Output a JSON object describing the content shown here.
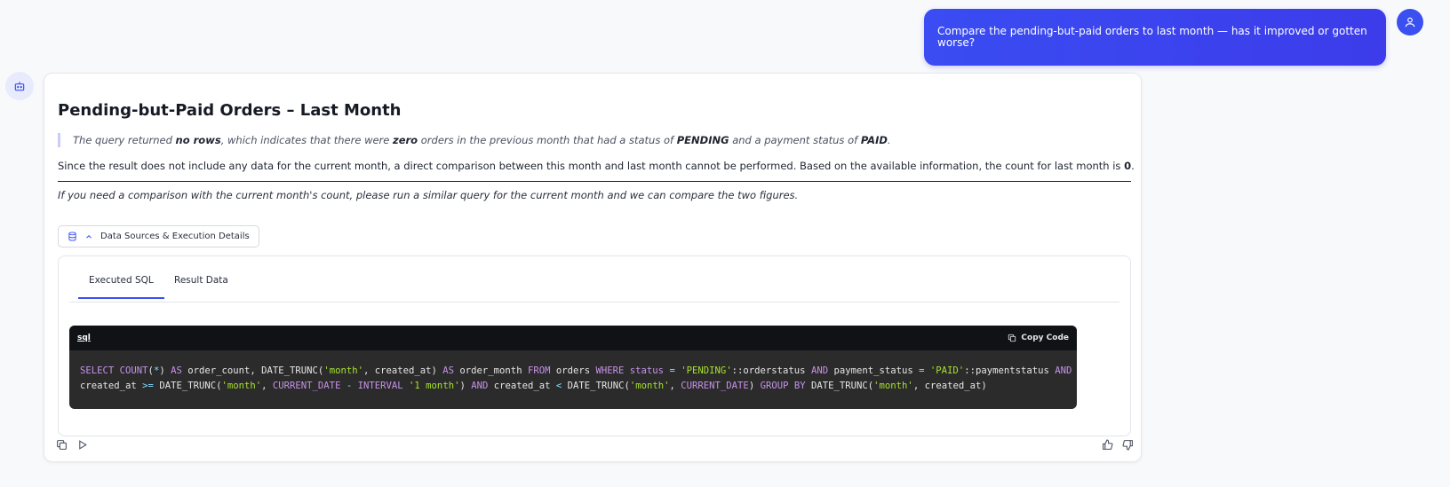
{
  "user_message": {
    "text": "Compare the pending-but-paid orders to last month — has it improved or gotten worse?"
  },
  "assistant": {
    "title": "Pending-but-Paid Orders – Last Month",
    "quote": {
      "part1": "The query returned ",
      "bold1": "no rows",
      "part2": ", which indicates that there were ",
      "bold2": "zero",
      "part3": " orders in the previous month that had a status of ",
      "bold3": "PENDING",
      "part4": " and a payment status of ",
      "bold4": "PAID",
      "part5": "."
    },
    "paragraph": {
      "text": "Since the result does not include any data for the current month, a direct comparison between this month and last month cannot be performed. Based on the available information, the count for last month is ",
      "bold": "0",
      "end": "."
    },
    "italic_note": "If you need a comparison with the current month's count, please run a similar query for the current month and we can compare the two figures.",
    "data_sources_label": "Data Sources & Execution Details",
    "tabs": [
      "Executed SQL",
      "Result Data"
    ],
    "code": {
      "language": "sql",
      "copy_label": "Copy Code",
      "tokens_line1": [
        {
          "t": "SELECT ",
          "c": "kw"
        },
        {
          "t": "COUNT",
          "c": "kw"
        },
        {
          "t": "(",
          "c": ""
        },
        {
          "t": "*",
          "c": "op"
        },
        {
          "t": ") ",
          "c": ""
        },
        {
          "t": "AS",
          "c": "kw"
        },
        {
          "t": " order_count, DATE_TRUNC(",
          "c": ""
        },
        {
          "t": "'month'",
          "c": "str"
        },
        {
          "t": ", created_at) ",
          "c": ""
        },
        {
          "t": "AS",
          "c": "kw"
        },
        {
          "t": " order_month ",
          "c": ""
        },
        {
          "t": "FROM",
          "c": "kw"
        },
        {
          "t": " orders ",
          "c": ""
        },
        {
          "t": "WHERE",
          "c": "kw"
        },
        {
          "t": " ",
          "c": ""
        },
        {
          "t": "status",
          "c": "kw"
        },
        {
          "t": " ",
          "c": ""
        },
        {
          "t": "=",
          "c": "op"
        },
        {
          "t": " ",
          "c": ""
        },
        {
          "t": "'PENDING'",
          "c": "str"
        },
        {
          "t": "::orderstatus ",
          "c": ""
        },
        {
          "t": "AND",
          "c": "kw"
        },
        {
          "t": " payment_status ",
          "c": ""
        },
        {
          "t": "=",
          "c": "op"
        },
        {
          "t": " ",
          "c": ""
        },
        {
          "t": "'PAID'",
          "c": "str"
        },
        {
          "t": "::paymentstatus ",
          "c": ""
        },
        {
          "t": "AND",
          "c": "kw"
        }
      ],
      "tokens_line2": [
        {
          "t": "created_at ",
          "c": ""
        },
        {
          "t": ">=",
          "c": "op"
        },
        {
          "t": " DATE_TRUNC(",
          "c": ""
        },
        {
          "t": "'month'",
          "c": "str"
        },
        {
          "t": ", ",
          "c": ""
        },
        {
          "t": "CURRENT_DATE",
          "c": "kw"
        },
        {
          "t": " ",
          "c": ""
        },
        {
          "t": "-",
          "c": "op"
        },
        {
          "t": " ",
          "c": ""
        },
        {
          "t": "INTERVAL",
          "c": "kw"
        },
        {
          "t": " ",
          "c": ""
        },
        {
          "t": "'1 month'",
          "c": "str"
        },
        {
          "t": ") ",
          "c": ""
        },
        {
          "t": "AND",
          "c": "kw"
        },
        {
          "t": " created_at ",
          "c": ""
        },
        {
          "t": "<",
          "c": "op"
        },
        {
          "t": " DATE_TRUNC(",
          "c": ""
        },
        {
          "t": "'month'",
          "c": "str"
        },
        {
          "t": ", ",
          "c": ""
        },
        {
          "t": "CURRENT_DATE",
          "c": "kw"
        },
        {
          "t": ") ",
          "c": ""
        },
        {
          "t": "GROUP BY",
          "c": "kw"
        },
        {
          "t": " DATE_TRUNC(",
          "c": ""
        },
        {
          "t": "'month'",
          "c": "str"
        },
        {
          "t": ", created_at)",
          "c": ""
        }
      ]
    },
    "icons": {
      "bot": "robot-icon",
      "user": "user-icon",
      "database": "database-icon",
      "chevron": "chevron-up-icon",
      "copy": "copy-icon",
      "play": "play-icon",
      "thumbs_up": "thumbs-up-icon",
      "thumbs_down": "thumbs-down-icon"
    }
  },
  "colors": {
    "accent": "#3b50f0",
    "code_bg": "#2b2b2b",
    "code_header": "#101215"
  }
}
